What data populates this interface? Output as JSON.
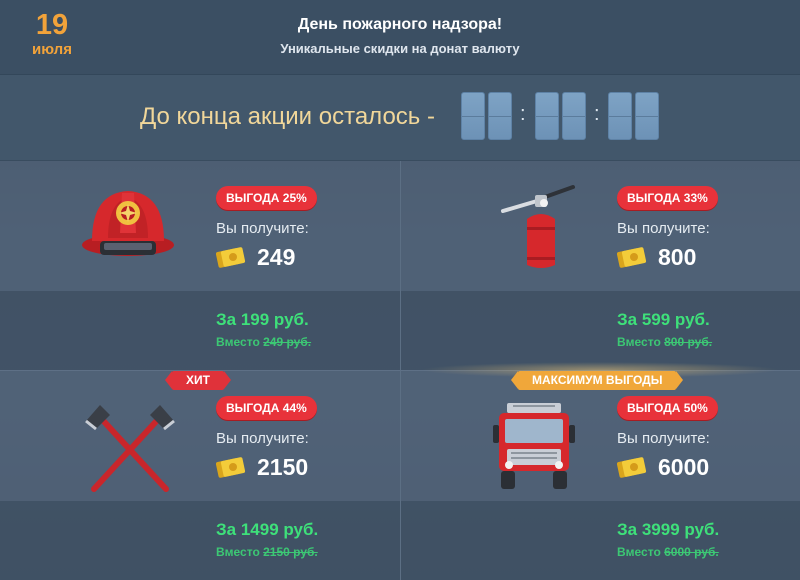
{
  "header": {
    "date_day": "19",
    "date_month": "июля",
    "title": "День пожарного надзора!",
    "subtitle": "Уникальные скидки на донат валюту"
  },
  "countdown": {
    "label": "До конца акции осталось -",
    "separator": ":"
  },
  "colors": {
    "badge": "#e8323a",
    "price": "#3ee07a",
    "date": "#f2a33a",
    "ribbon_hit": "#e0323a",
    "ribbon_max": "#f0a73a"
  },
  "offers": [
    {
      "item": "firefighter-helmet",
      "badge": "ВЫГОДА 25%",
      "receive_label": "Вы получите:",
      "amount": "249",
      "price": "За 199 руб.",
      "old_price_prefix": "Вместо",
      "old_price": "249 руб."
    },
    {
      "item": "fire-extinguisher",
      "badge": "ВЫГОДА 33%",
      "receive_label": "Вы получите:",
      "amount": "800",
      "price": "За 599 руб.",
      "old_price_prefix": "Вместо",
      "old_price": "800 руб."
    },
    {
      "item": "crossed-axes",
      "ribbon": "ХИТ",
      "badge": "ВЫГОДА 44%",
      "receive_label": "Вы получите:",
      "amount": "2150",
      "price": "За 1499 руб.",
      "old_price_prefix": "Вместо",
      "old_price": "2150 руб."
    },
    {
      "item": "fire-truck",
      "ribbon": "МАКСИМУМ ВЫГОДЫ",
      "badge": "ВЫГОДА 50%",
      "receive_label": "Вы получите:",
      "amount": "6000",
      "price": "За 3999 руб.",
      "old_price_prefix": "Вместо",
      "old_price": "6000 руб."
    }
  ]
}
